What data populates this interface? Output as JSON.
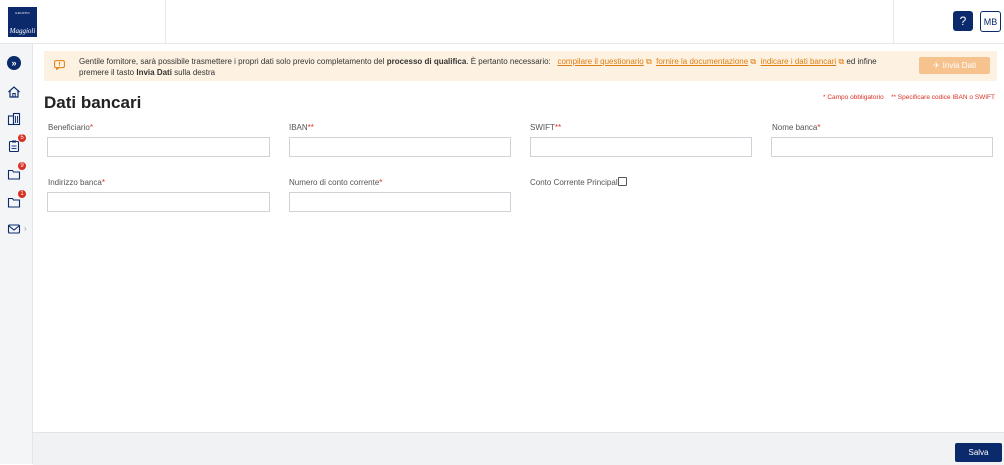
{
  "header": {
    "logo_top": "GRUPPO",
    "logo_name": "Maggioli",
    "help_label": "?",
    "user_initials": "MB"
  },
  "sidebar": {
    "collapse_icon": "double-chevron-right-icon",
    "items": [
      {
        "icon": "home-icon",
        "badge": ""
      },
      {
        "icon": "buildings-icon",
        "badge": ""
      },
      {
        "icon": "clipboard-icon",
        "badge": "5"
      },
      {
        "icon": "folder-icon",
        "badge": "9"
      },
      {
        "icon": "folder-icon",
        "badge": "1"
      },
      {
        "icon": "mail-icon",
        "badge": ""
      }
    ],
    "expand_icon": "chevron-right-icon"
  },
  "notice": {
    "icon": "alert-icon",
    "text_1": "Gentile fornitore, sarà possibile trasmettere i propri dati solo previo completamento del ",
    "bold_1": "processo di qualifica",
    "text_2": ". È pertanto necessario: ",
    "link_1": "compilare il questionario",
    "link_2": "fornire la documentazione",
    "link_3": "indicare i dati bancari",
    "text_3": " ed infine premere il tasto ",
    "bold_2": "Invia Dati",
    "text_4": " sulla destra",
    "send_button": "Invia Dati",
    "accent_color": "#e07c0c"
  },
  "page": {
    "title": "Dati bancari",
    "legend_required": "* Campo obbligatorio",
    "legend_iban_swift": "** Specificare codice IBAN o SWIFT"
  },
  "form": {
    "beneficiario": {
      "label": "Beneficiario",
      "mark": "*",
      "value": ""
    },
    "iban": {
      "label": "IBAN",
      "mark": "**",
      "value": ""
    },
    "swift": {
      "label": "SWIFT",
      "mark": "**",
      "value": ""
    },
    "nome_banca": {
      "label": "Nome banca",
      "mark": "*",
      "value": ""
    },
    "indirizzo_banca": {
      "label": "Indirizzo banca",
      "mark": "*",
      "value": ""
    },
    "numero_conto": {
      "label": "Numero di conto corrente",
      "mark": "*",
      "value": ""
    },
    "conto_principale": {
      "label": "Conto Corrente Principale",
      "checked": false
    }
  },
  "footer": {
    "save_button": "Salva"
  },
  "colors": {
    "primary": "#0b2a6b",
    "required": "#d93025",
    "notice_bg": "#fdf2e2"
  }
}
